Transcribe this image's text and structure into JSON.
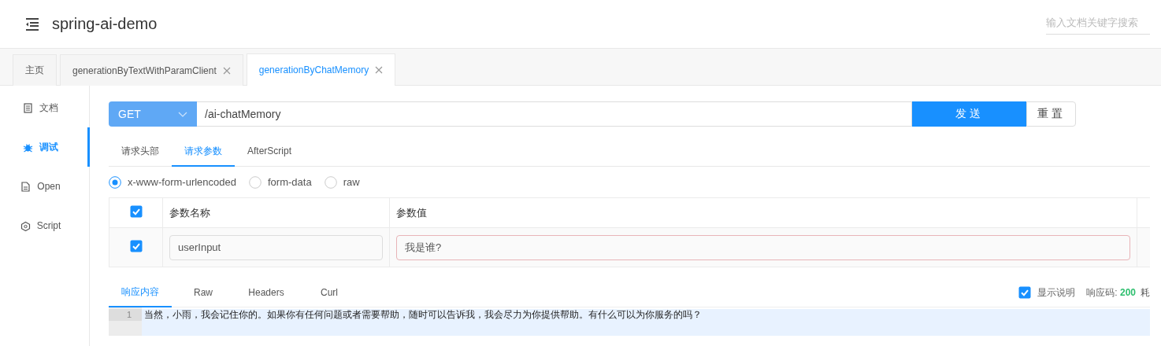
{
  "header": {
    "title": "spring-ai-demo",
    "search": {
      "placeholder": "输入文档关键字搜索"
    }
  },
  "tabs": [
    {
      "label": "主页",
      "closable": false,
      "selected": false
    },
    {
      "label": "generationByTextWithParamClient",
      "closable": true,
      "selected": false
    },
    {
      "label": "generationByChatMemory",
      "closable": true,
      "selected": true
    }
  ],
  "sidebar": {
    "items": [
      {
        "label": "文档",
        "selected": false
      },
      {
        "label": "调试",
        "selected": true
      },
      {
        "label": "Open",
        "selected": false
      },
      {
        "label": "Script",
        "selected": false
      }
    ]
  },
  "request": {
    "method": "GET",
    "url": "/ai-chatMemory",
    "send": "发送",
    "reset": "重置"
  },
  "param_tabs": [
    {
      "label": "请求头部",
      "selected": false
    },
    {
      "label": "请求参数",
      "selected": true
    },
    {
      "label": "AfterScript",
      "selected": false
    }
  ],
  "body_types": [
    {
      "label": "x-www-form-urlencoded",
      "selected": true
    },
    {
      "label": "form-data",
      "selected": false
    },
    {
      "label": "raw",
      "selected": false
    }
  ],
  "params_table": {
    "all_checked": true,
    "columns": [
      "参数名称",
      "参数值"
    ],
    "rows": [
      {
        "checked": true,
        "name": "userInput",
        "value": "我是谁?",
        "invalid": true
      }
    ]
  },
  "response": {
    "tabs": [
      {
        "label": "响应内容",
        "selected": true
      },
      {
        "label": "Raw",
        "selected": false
      },
      {
        "label": "Headers",
        "selected": false
      },
      {
        "label": "Curl",
        "selected": false
      }
    ],
    "show_notes": {
      "label": "显示说明",
      "checked": true
    },
    "status_label": "响应码:",
    "status_code": "200",
    "time_label": "耗",
    "lines": [
      {
        "number": "1",
        "text": "当然，小雨，我会记住你的。如果你有任何问题或者需要帮助，随时可以告诉我，我会尽力为你提供帮助。有什么可以为你服务的吗？",
        "highlighted": true
      }
    ]
  }
}
